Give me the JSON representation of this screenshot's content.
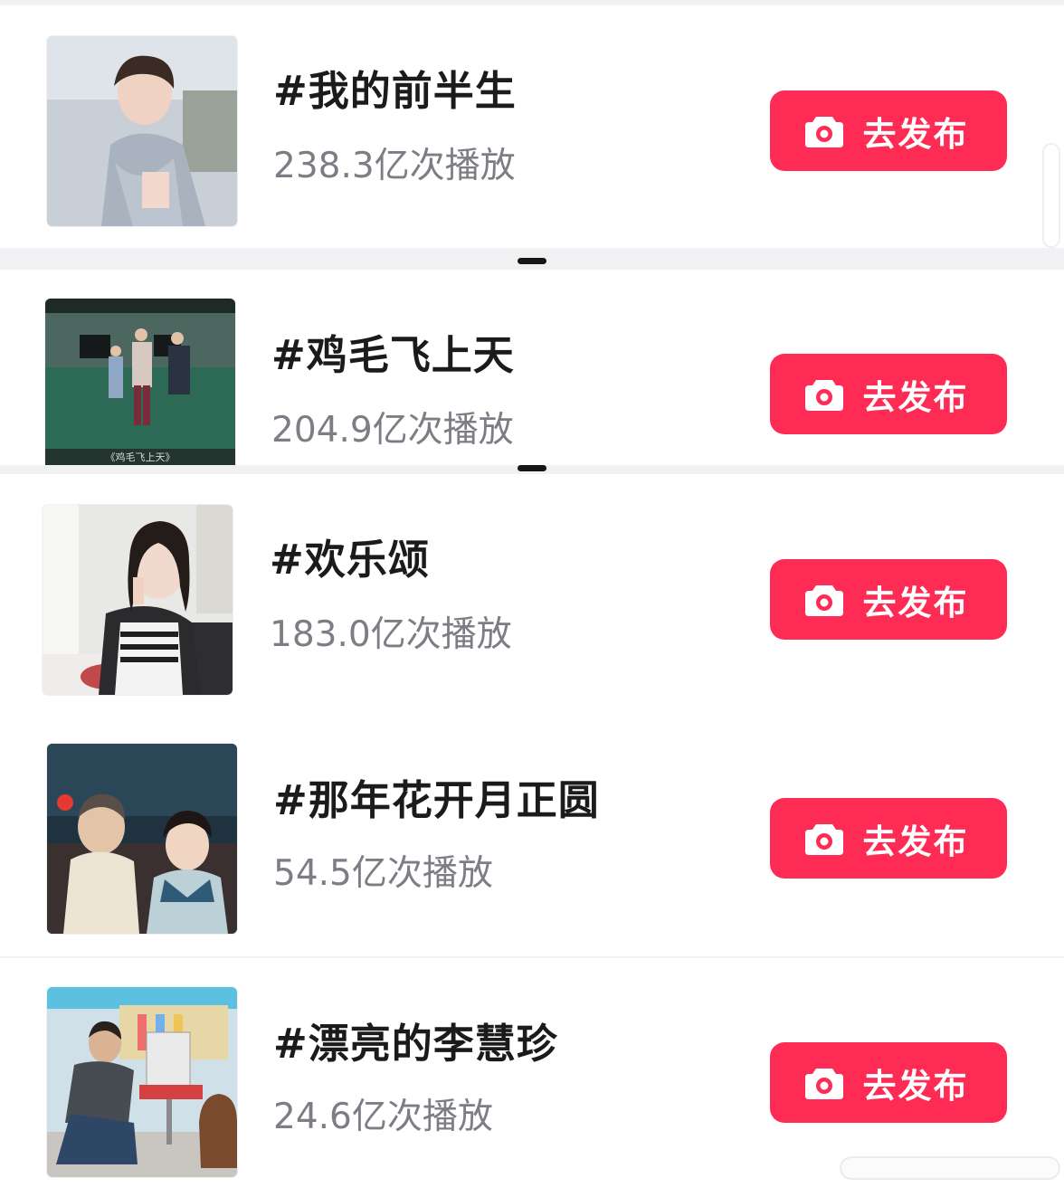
{
  "colors": {
    "accent": "#fe2c55",
    "title": "#1b1b1d",
    "subtitle": "#7d7d85"
  },
  "items": [
    {
      "title": "#我的前半生",
      "plays": "238.3亿次播放",
      "button_label": "去发布",
      "button_icon": "camera-icon"
    },
    {
      "title": "#鸡毛飞上天",
      "plays": "204.9亿次播放",
      "button_label": "去发布",
      "button_icon": "camera-icon",
      "thumb_caption": "《鸡毛飞上天》"
    },
    {
      "title": "#欢乐颂",
      "plays": "183.0亿次播放",
      "button_label": "去发布",
      "button_icon": "camera-icon"
    },
    {
      "title": "#那年花开月正圆",
      "plays": "54.5亿次播放",
      "button_label": "去发布",
      "button_icon": "camera-icon"
    },
    {
      "title": "#漂亮的李慧珍",
      "plays": "24.6亿次播放",
      "button_label": "去发布",
      "button_icon": "camera-icon"
    }
  ]
}
